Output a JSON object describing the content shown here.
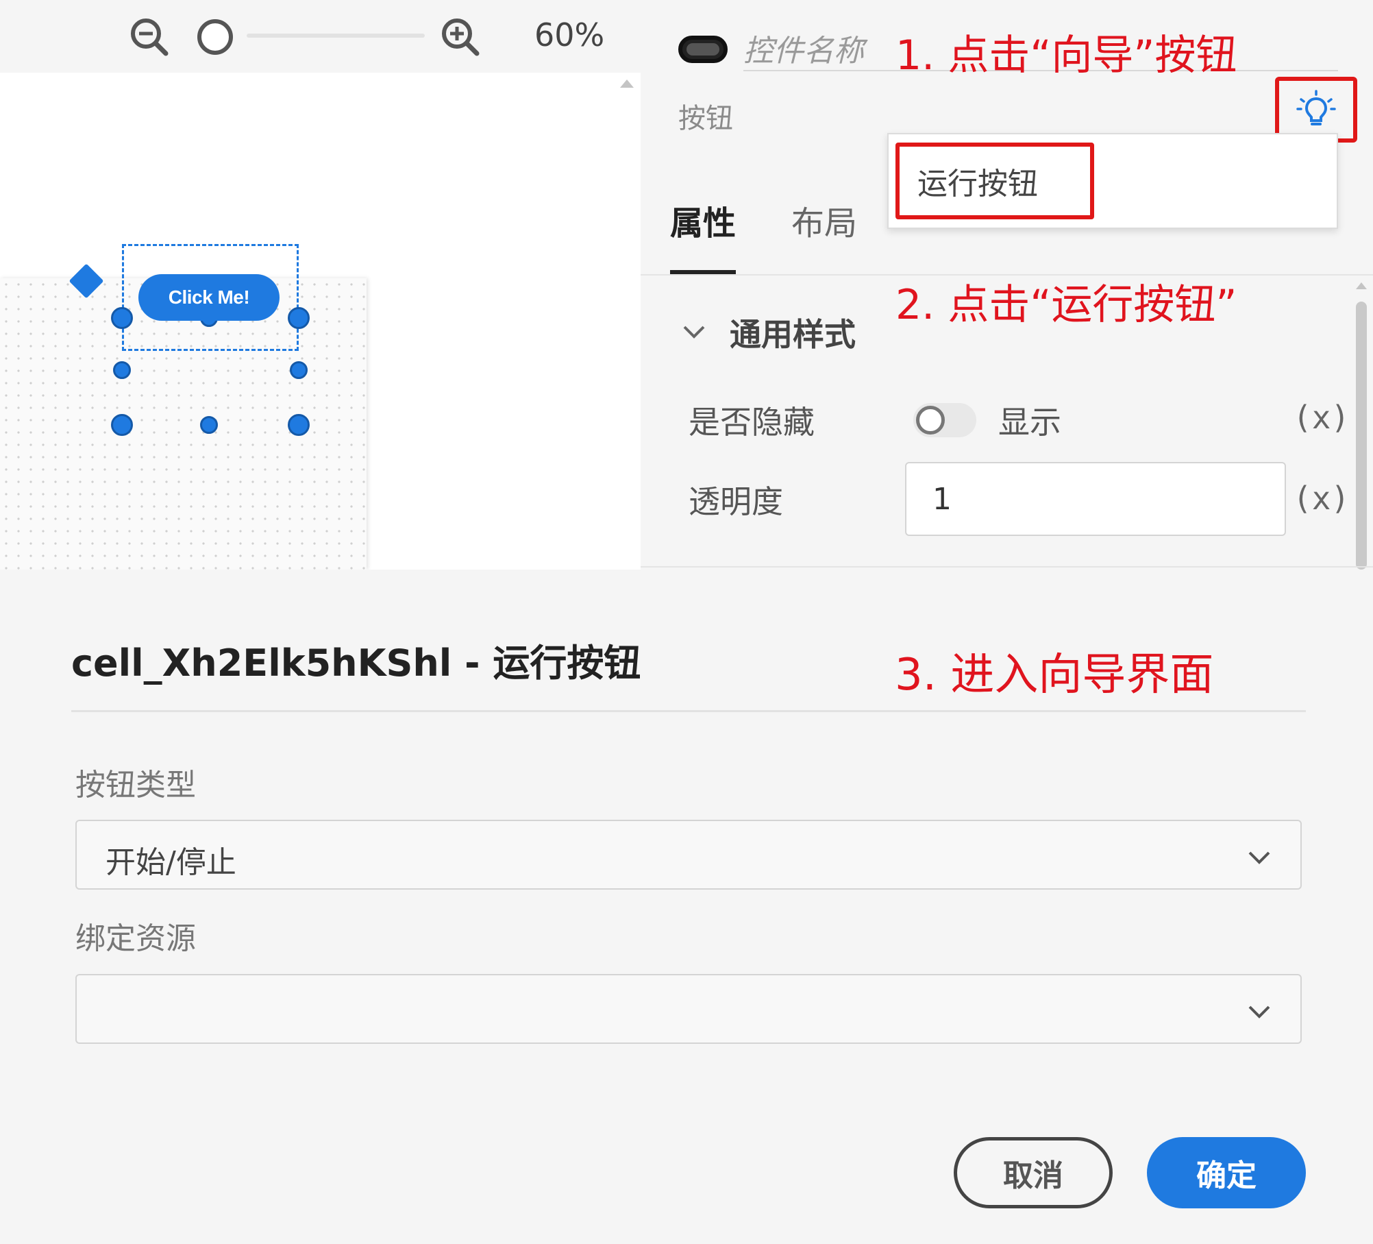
{
  "toolbar": {
    "zoom_out_icon": "zoom-out-icon",
    "zoom_in_icon": "zoom-in-icon",
    "zoom_level": "60%"
  },
  "canvas": {
    "button_label": "Click Me!"
  },
  "panel": {
    "name_placeholder": "控件名称",
    "type_label": "按钮",
    "wizard_icon": "lightbulb-icon",
    "dropdown_item": "运行按钮",
    "tabs": [
      {
        "label": "属性",
        "active": true
      },
      {
        "label": "布局",
        "active": false
      }
    ],
    "section_title": "通用样式",
    "hidden_label": "是否隐藏",
    "hidden_state": "显示",
    "opacity_label": "透明度",
    "opacity_value": "1",
    "variable_label": "(x)"
  },
  "annotations": {
    "step1": "1. 点击“向导”按钮",
    "step2": "2. 点击“运行按钮”",
    "step3": "3. 进入向导界面"
  },
  "dialog": {
    "title": "cell_Xh2Elk5hKShl - 运行按钮",
    "type_label": "按钮类型",
    "type_value": "开始/停止",
    "resource_label": "绑定资源",
    "resource_value": "",
    "cancel_label": "取消",
    "ok_label": "确定"
  },
  "colors": {
    "accent": "#1f7ae0",
    "annotation_red": "#e0141e"
  }
}
